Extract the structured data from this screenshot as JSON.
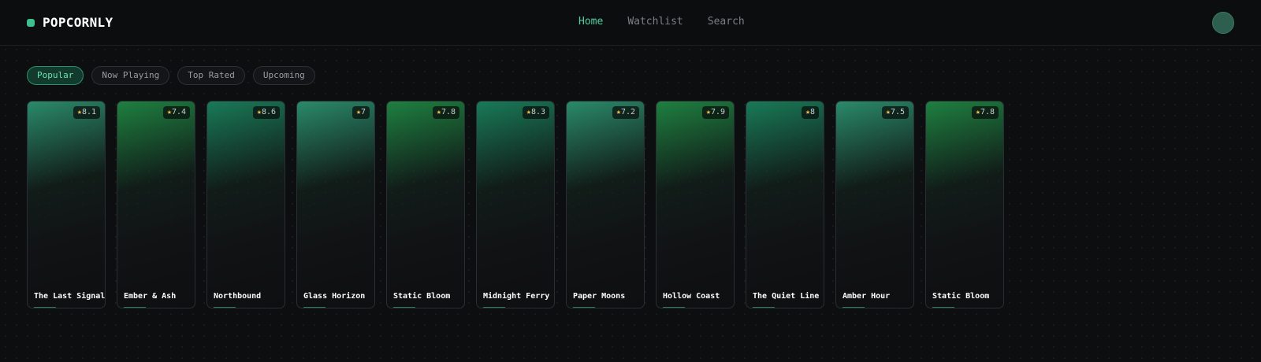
{
  "brand": {
    "name": "POPCORNLY",
    "dot_color": "#3fbf8f"
  },
  "nav": [
    {
      "label": "Home",
      "active": true
    },
    {
      "label": "Watchlist",
      "active": false
    },
    {
      "label": "Search",
      "active": false
    }
  ],
  "colors": {
    "accent": "#4fd1a0",
    "background": "#0d0e10",
    "star": "#f0c24a",
    "avatar": "#2e5e4e"
  },
  "filters": [
    {
      "label": "Popular",
      "active": true
    },
    {
      "label": "Now Playing",
      "active": false
    },
    {
      "label": "Top Rated",
      "active": false
    },
    {
      "label": "Upcoming",
      "active": false
    }
  ],
  "movies": [
    {
      "title": "The Last Signal",
      "rating": "8.1",
      "hue": "#2a8a6a"
    },
    {
      "title": "Ember & Ash",
      "rating": "7.4",
      "hue": "#1e8040"
    },
    {
      "title": "Northbound",
      "rating": "8.6",
      "hue": "#197a58"
    },
    {
      "title": "Glass Horizon",
      "rating": "7",
      "hue": "#2a8a6a"
    },
    {
      "title": "Static Bloom",
      "rating": "7.8",
      "hue": "#1e8040"
    },
    {
      "title": "Midnight Ferry",
      "rating": "8.3",
      "hue": "#197a58"
    },
    {
      "title": "Paper Moons",
      "rating": "7.2",
      "hue": "#2a8a6a"
    },
    {
      "title": "Hollow Coast",
      "rating": "7.9",
      "hue": "#1e8040"
    },
    {
      "title": "The Quiet Line",
      "rating": "8",
      "hue": "#197a58"
    },
    {
      "title": "Amber Hour",
      "rating": "7.5",
      "hue": "#2a8a6a"
    },
    {
      "title": "Static Bloom",
      "rating": "7.8",
      "hue": "#1e8040"
    }
  ]
}
